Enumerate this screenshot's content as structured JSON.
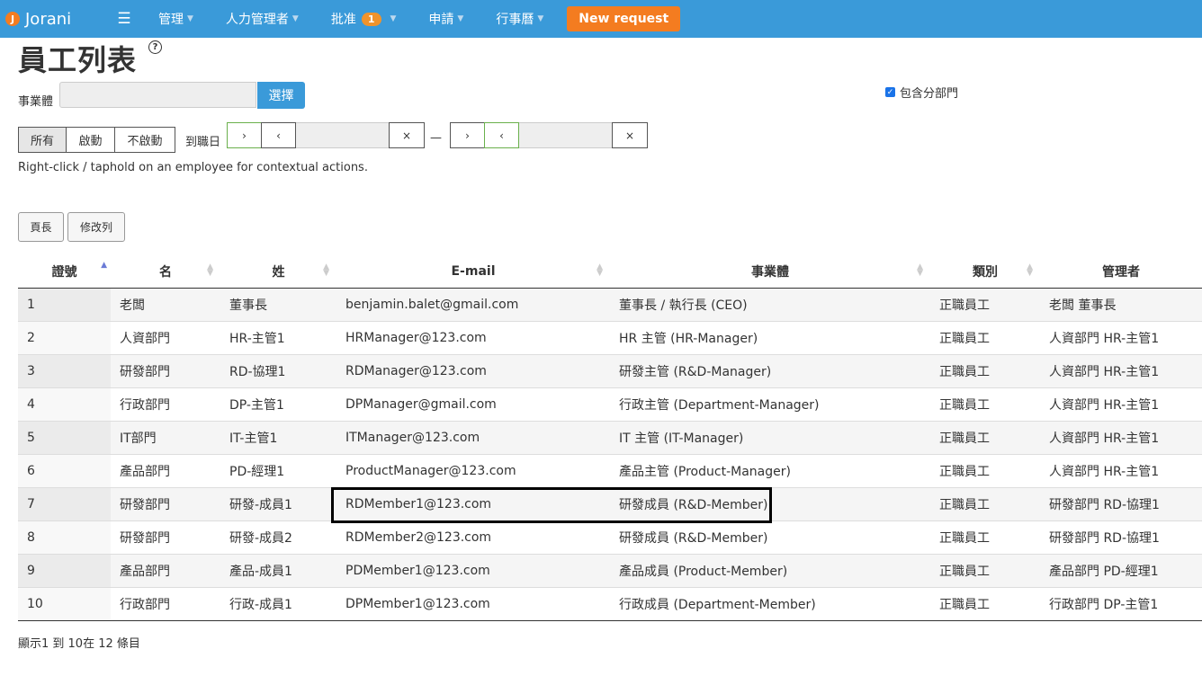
{
  "nav": {
    "brand": "Jorani",
    "items": [
      {
        "label": "管理"
      },
      {
        "label": "人力管理者"
      },
      {
        "label": "批准",
        "badge": "1"
      },
      {
        "label": "申請"
      },
      {
        "label": "行事曆"
      }
    ],
    "new_request": "New request"
  },
  "page": {
    "title": "員工列表",
    "help": "?"
  },
  "filters": {
    "entity_label": "事業體",
    "entity_value": "",
    "select_button": "選擇",
    "include_sub": "包含分部門",
    "status_buttons": [
      "所有",
      "啟動",
      "不啟動"
    ],
    "hire_label": "到職日",
    "next": "›",
    "prev": "‹",
    "clear": "×",
    "range_sep": "—"
  },
  "hint": "Right-click / taphold on an employee for contextual actions.",
  "toolbar": {
    "page_length": "頁長",
    "columns": "修改列"
  },
  "table": {
    "headers": [
      "證號",
      "名",
      "姓",
      "E-mail",
      "事業體",
      "類別",
      "管理者"
    ],
    "rows": [
      [
        "1",
        "老闆",
        "董事長",
        "benjamin.balet@gmail.com",
        "董事長 / 執行長 (CEO)",
        "正職員工",
        "老闆 董事長"
      ],
      [
        "2",
        "人資部門",
        "HR-主管1",
        "HRManager@123.com",
        "HR 主管 (HR-Manager)",
        "正職員工",
        "人資部門 HR-主管1"
      ],
      [
        "3",
        "研發部門",
        "RD-協理1",
        "RDManager@123.com",
        "研發主管 (R&D-Manager)",
        "正職員工",
        "人資部門 HR-主管1"
      ],
      [
        "4",
        "行政部門",
        "DP-主管1",
        "DPManager@gmail.com",
        "行政主管 (Department-Manager)",
        "正職員工",
        "人資部門 HR-主管1"
      ],
      [
        "5",
        "IT部門",
        "IT-主管1",
        "ITManager@123.com",
        "IT 主管 (IT-Manager)",
        "正職員工",
        "人資部門 HR-主管1"
      ],
      [
        "6",
        "產品部門",
        "PD-經理1",
        "ProductManager@123.com",
        "產品主管 (Product-Manager)",
        "正職員工",
        "人資部門 HR-主管1"
      ],
      [
        "7",
        "研發部門",
        "研發-成員1",
        "RDMember1@123.com",
        "研發成員 (R&D-Member)",
        "正職員工",
        "研發部門 RD-協理1"
      ],
      [
        "8",
        "研發部門",
        "研發-成員2",
        "RDMember2@123.com",
        "研發成員 (R&D-Member)",
        "正職員工",
        "研發部門 RD-協理1"
      ],
      [
        "9",
        "產品部門",
        "產品-成員1",
        "PDMember1@123.com",
        "產品成員 (Product-Member)",
        "正職員工",
        "產品部門 PD-經理1"
      ],
      [
        "10",
        "行政部門",
        "行政-成員1",
        "DPMember1@123.com",
        "行政成員 (Department-Member)",
        "正職員工",
        "行政部門 DP-主管1"
      ]
    ]
  },
  "footer": "顯示1 到 10在 12 條目"
}
